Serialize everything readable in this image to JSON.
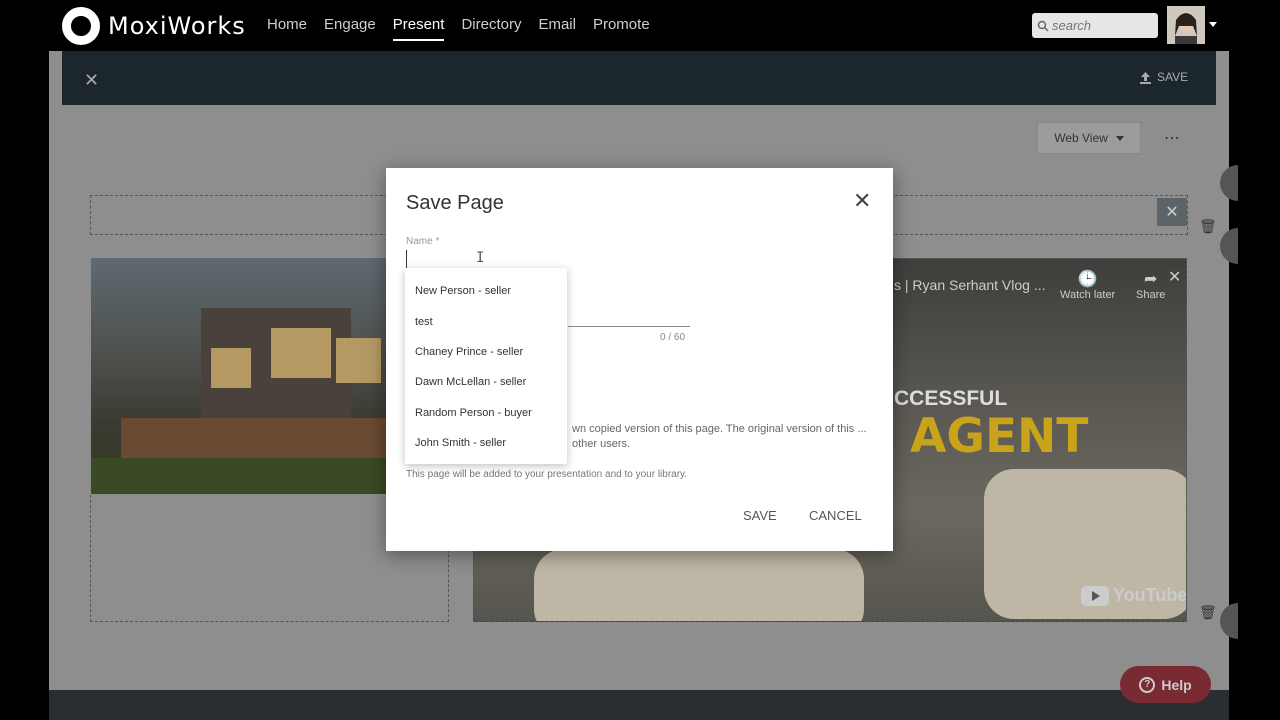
{
  "app": {
    "brand": "MoxiWorks"
  },
  "nav": {
    "items": [
      {
        "label": "Home"
      },
      {
        "label": "Engage"
      },
      {
        "label": "Present"
      },
      {
        "label": "Directory"
      },
      {
        "label": "Email"
      },
      {
        "label": "Promote"
      }
    ],
    "active": "Present",
    "search_placeholder": "search"
  },
  "editor": {
    "save_label": "SAVE",
    "view_select": "Web View",
    "video": {
      "title": "s | Ryan Serhant Vlog ...",
      "watch_later": "Watch later",
      "share": "Share",
      "overlay_line1": "CCESSFUL",
      "overlay_line2": "AGENT",
      "brand": "YouTube"
    }
  },
  "help": {
    "label": "Help"
  },
  "modal": {
    "title": "Save Page",
    "name_label": "Name *",
    "name_value": "",
    "counter": "0 / 60",
    "info": "wn copied version of this page. The original version of this ... other users.",
    "footnote": "This page will be added to your presentation and to your library.",
    "save_label": "SAVE",
    "cancel_label": "CANCEL",
    "suggestions": [
      "New Person - seller",
      "test",
      "Chaney Prince - seller",
      "Dawn McLellan - seller",
      "Random Person - buyer",
      "John Smith - seller"
    ]
  },
  "colors": {
    "nav_bg": "#000000",
    "editor_bar": "#1c272d",
    "help": "#7a2a33"
  }
}
